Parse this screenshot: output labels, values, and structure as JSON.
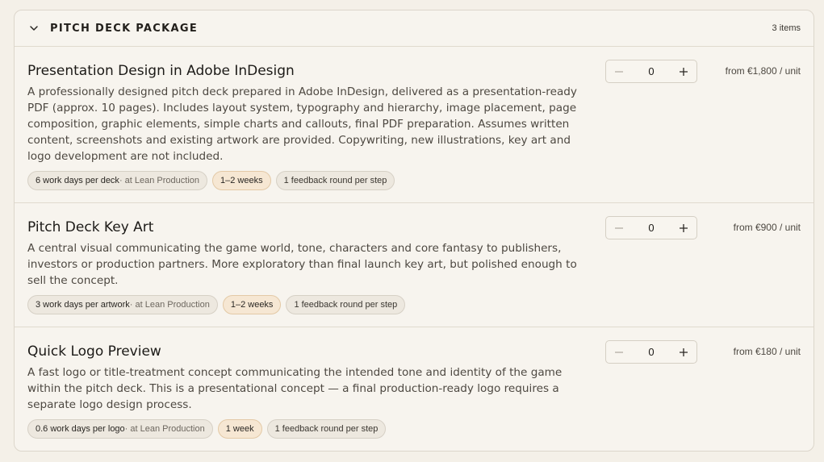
{
  "section": {
    "title": "PITCH DECK PACKAGE",
    "count": "3 items"
  },
  "items": [
    {
      "title": "Presentation Design in Adobe InDesign",
      "description": "A professionally designed pitch deck prepared in Adobe InDesign, delivered as a presentation-ready PDF (approx. 10 pages). Includes layout system, typography and hierarchy, image placement, page composition, graphic elements, simple charts and callouts, final PDF preparation. Assumes written content, screenshots and existing artwork are provided. Copywriting, new illustrations, key art and logo development are not included.",
      "effort": "6 work days per deck",
      "effort_sub": " · at Lean Production",
      "timeline": "1–2 weeks",
      "feedback": "1 feedback round per step",
      "quantity": "0",
      "price": "from €1,800 / unit"
    },
    {
      "title": "Pitch Deck Key Art",
      "description": "A central visual communicating the game world, tone, characters and core fantasy to publishers, investors or production partners. More exploratory than final launch key art, but polished enough to sell the concept.",
      "effort": "3 work days per artwork",
      "effort_sub": " · at Lean Production",
      "timeline": "1–2 weeks",
      "feedback": "1 feedback round per step",
      "quantity": "0",
      "price": "from €900 / unit"
    },
    {
      "title": "Quick Logo Preview",
      "description": "A fast logo or title-treatment concept communicating the intended tone and identity of the game within the pitch deck. This is a presentational concept — a final production-ready logo requires a separate logo design process.",
      "effort": "0.6 work days per logo",
      "effort_sub": " · at Lean Production",
      "timeline": "1 week",
      "feedback": "1 feedback round per step",
      "quantity": "0",
      "price": "from €180 / unit"
    }
  ],
  "icons": {
    "collapse": "chevron-down-icon",
    "decrement": "minus-icon",
    "increment": "plus-icon"
  }
}
